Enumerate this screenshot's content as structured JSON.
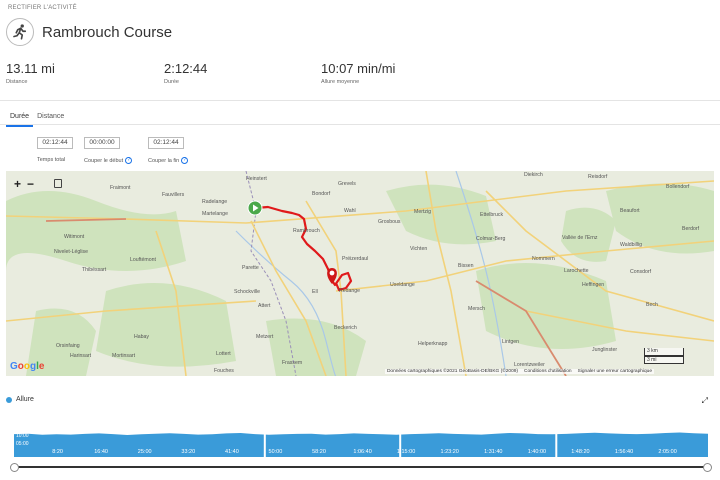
{
  "breadcrumb": "RECTIFIER L'ACTIVITÉ",
  "title": "Rambrouch Course",
  "stats": [
    {
      "value": "13.11 mi",
      "label": "Distance"
    },
    {
      "value": "2:12:44",
      "label": "Durée"
    },
    {
      "value": "10:07 min/mi",
      "label": "Allure moyenne"
    }
  ],
  "tabs": [
    {
      "label": "Durée",
      "active": true
    },
    {
      "label": "Distance",
      "active": false
    }
  ],
  "time_fields": [
    {
      "value": "02:12:44",
      "label": "Temps total"
    },
    {
      "value": "00:00:00",
      "label": "Couper le début"
    },
    {
      "value": "02:12:44",
      "label": "Couper la fin"
    }
  ],
  "map": {
    "zoom_in": "+",
    "zoom_out": "−",
    "attribution": "Données cartographiques ©2021 GeoBasis-DE/BKG (©2009)",
    "terms": "Conditions d'utilisation",
    "report": "Signaler une erreur cartographique",
    "scale_km": "3 km",
    "scale_mi": "3 mi",
    "places": [
      {
        "name": "Fraimont"
      },
      {
        "name": "Fauvillers"
      },
      {
        "name": "Radelange"
      },
      {
        "name": "Martelange"
      },
      {
        "name": "Witimont"
      },
      {
        "name": "Nivelet-Léglise"
      },
      {
        "name": "Louftémont"
      },
      {
        "name": "Thibéssart"
      },
      {
        "name": "Parette"
      },
      {
        "name": "Schockville"
      },
      {
        "name": "Attert"
      },
      {
        "name": "Habay"
      },
      {
        "name": "Orsinfaing"
      },
      {
        "name": "Harinsart"
      },
      {
        "name": "Mortinsart"
      },
      {
        "name": "Metzert"
      },
      {
        "name": "Lottert"
      },
      {
        "name": "Heinstert"
      },
      {
        "name": "Grevels"
      },
      {
        "name": "Bondorf"
      },
      {
        "name": "Wahl"
      },
      {
        "name": "Grosbous"
      },
      {
        "name": "Rambrouch"
      },
      {
        "name": "Mertzig"
      },
      {
        "name": "Ettelbruck"
      },
      {
        "name": "Diekirch"
      },
      {
        "name": "Beaufort"
      },
      {
        "name": "Reisdorf"
      },
      {
        "name": "Bollendorf"
      },
      {
        "name": "Préizerdaul"
      },
      {
        "name": "Vichten"
      },
      {
        "name": "Colmar-Berg"
      },
      {
        "name": "Vallée de l'Ernz"
      },
      {
        "name": "Waldbillig"
      },
      {
        "name": "Berdorf"
      },
      {
        "name": "Useldange"
      },
      {
        "name": "Bissen"
      },
      {
        "name": "Nommern"
      },
      {
        "name": "Larochette"
      },
      {
        "name": "Consdorf"
      },
      {
        "name": "Redange"
      },
      {
        "name": "Beckerich"
      },
      {
        "name": "Mersch"
      },
      {
        "name": "Heffingen"
      },
      {
        "name": "Bech"
      },
      {
        "name": "Helperknapp"
      },
      {
        "name": "Lintgen"
      },
      {
        "name": "Junglinster"
      },
      {
        "name": "Frassem"
      },
      {
        "name": "Lorentzweiler"
      },
      {
        "name": "Ell"
      },
      {
        "name": "Fouches"
      }
    ]
  },
  "chart_data": {
    "type": "area",
    "title": "Allure",
    "xlabel": "",
    "ylabel": "",
    "x_ticks": [
      "8:20",
      "16:40",
      "25:00",
      "33:20",
      "41:40",
      "50:00",
      "58:20",
      "1:06:40",
      "1:15:00",
      "1:23:20",
      "1:31:40",
      "1:40:00",
      "1:48:20",
      "1:56:40",
      "2:05:00"
    ],
    "y_ticks": [
      "15:00",
      "10:00",
      "05:00"
    ],
    "x_range_seconds": [
      0,
      7964
    ],
    "series_color": "#3a9bd9",
    "pace_min_per_mi": [
      10.1,
      10.3,
      9.8,
      10.0,
      9.9,
      10.2,
      10.4,
      10.1,
      9.7,
      10.0,
      10.3,
      10.5,
      10.2,
      9.9,
      10.0,
      10.4,
      10.6,
      10.1,
      9.8,
      10.0,
      10.2,
      10.3,
      9.9,
      10.1,
      10.4,
      10.2,
      10.0,
      9.8,
      10.1,
      10.3,
      10.5,
      10.2,
      10.0,
      9.9,
      10.3,
      10.6,
      10.4,
      10.1,
      10.0,
      10.2,
      10.5,
      10.7,
      10.4,
      10.2,
      10.1,
      10.3,
      10.6,
      10.8,
      10.5,
      10.3
    ],
    "gaps": [
      0.36,
      0.555,
      0.78
    ]
  }
}
